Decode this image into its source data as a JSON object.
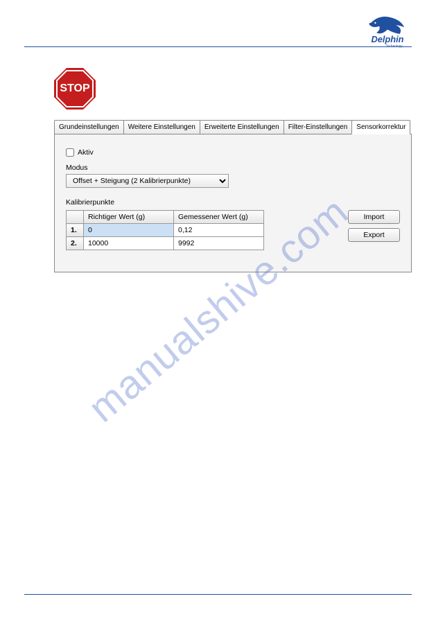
{
  "logo": {
    "name": "Delphin",
    "subtitle": "Technology"
  },
  "stop": {
    "label": "STOP"
  },
  "tabs": [
    {
      "label": "Grundeinstellungen",
      "active": false
    },
    {
      "label": "Weitere Einstellungen",
      "active": false
    },
    {
      "label": "Erweiterte Einstellungen",
      "active": false
    },
    {
      "label": "Filter-Einstellungen",
      "active": false
    },
    {
      "label": "Sensorkorrektur",
      "active": true
    }
  ],
  "form": {
    "active_label": "Aktiv",
    "active_checked": false,
    "modus_label": "Modus",
    "modus_value": "Offset + Steigung (2 Kalibrierpunkte)",
    "kalibrier_label": "Kalibrierpunkte",
    "table": {
      "headers": [
        "",
        "Richtiger Wert (g)",
        "Gemessener Wert (g)"
      ],
      "rows": [
        {
          "num": "1.",
          "correct": "0",
          "measured": "0,12",
          "selected": true
        },
        {
          "num": "2.",
          "correct": "10000",
          "measured": "9992",
          "selected": false
        }
      ]
    },
    "buttons": {
      "import": "Import",
      "export": "Export"
    }
  },
  "watermark": "manualshive.com"
}
